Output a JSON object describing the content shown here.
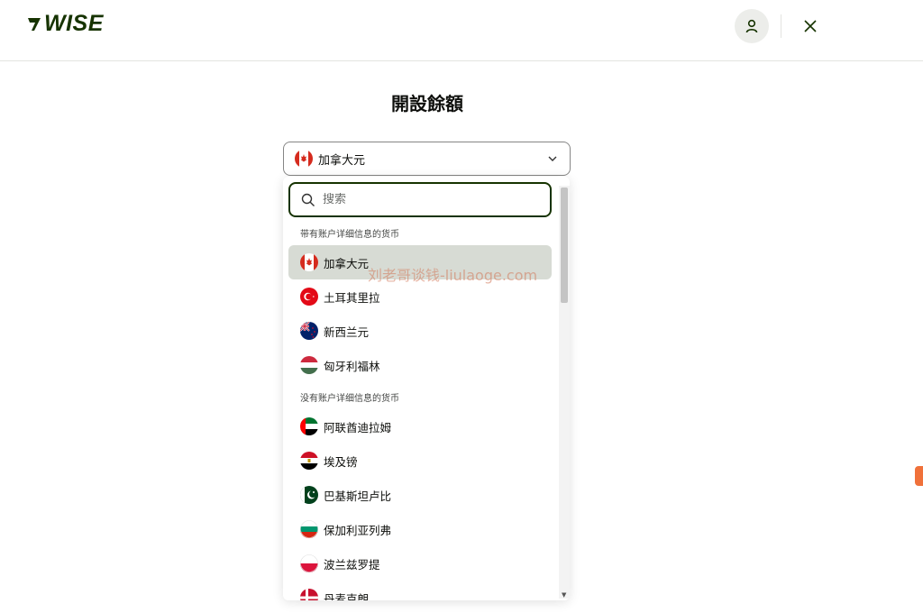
{
  "header": {
    "logo_text": "WISE",
    "brand_color": "#163300",
    "account_icon": "person-icon",
    "close_icon": "close-icon"
  },
  "page": {
    "title": "開設餘額"
  },
  "currency_select": {
    "selected_label": "加拿大元",
    "selected_flag": "flag-canada-icon",
    "search_placeholder": "搜索",
    "search_value": "",
    "groups": [
      {
        "label": "带有账户详细信息的货币",
        "items": [
          {
            "label": "加拿大元",
            "flag": "flag-canada-icon",
            "selected": true
          },
          {
            "label": "土耳其里拉",
            "flag": "flag-turkey-icon"
          },
          {
            "label": "新西兰元",
            "flag": "flag-new-zealand-icon"
          },
          {
            "label": "匈牙利福林",
            "flag": "flag-hungary-icon"
          }
        ]
      },
      {
        "label": "没有账户详细信息的货币",
        "items": [
          {
            "label": "阿联酋迪拉姆",
            "flag": "flag-uae-icon"
          },
          {
            "label": "埃及镑",
            "flag": "flag-egypt-icon"
          },
          {
            "label": "巴基斯坦卢比",
            "flag": "flag-pakistan-icon"
          },
          {
            "label": "保加利亚列弗",
            "flag": "flag-bulgaria-icon"
          },
          {
            "label": "波兰兹罗提",
            "flag": "flag-poland-icon"
          },
          {
            "label": "丹麦克朗",
            "flag": "flag-denmark-icon"
          }
        ]
      }
    ]
  },
  "watermark": "刘老哥谈钱-liulaoge.com"
}
